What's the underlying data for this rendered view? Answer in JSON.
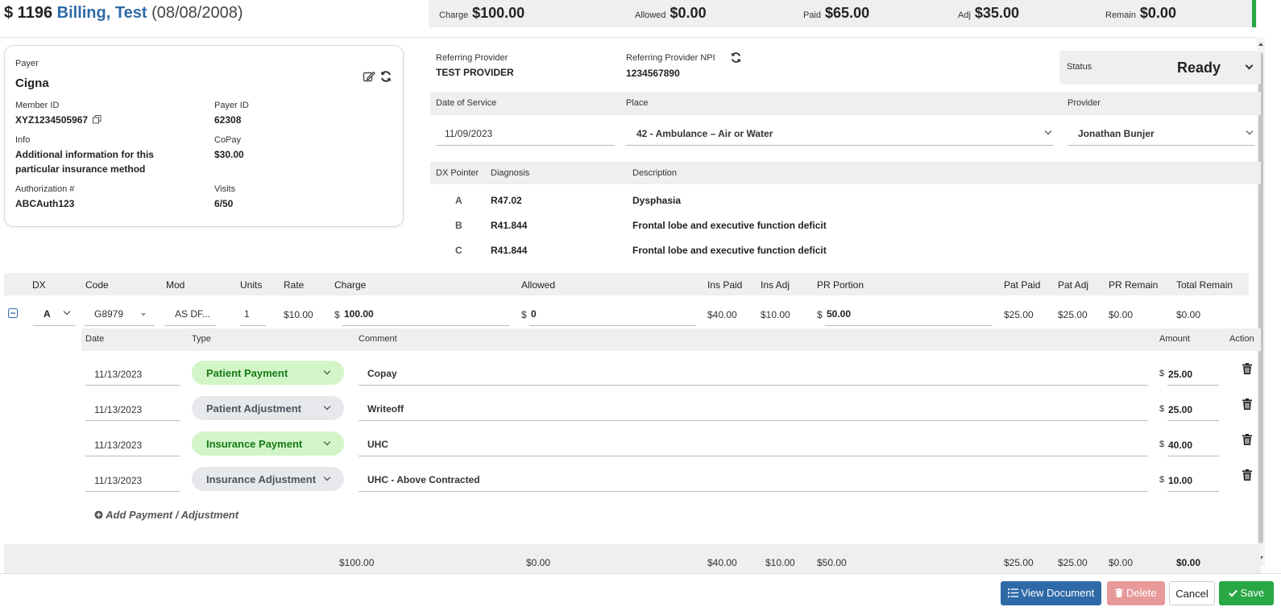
{
  "header": {
    "patient_id": "$ 1196",
    "patient_name": "Billing, Test",
    "dob": "(08/08/2008)"
  },
  "summary": [
    {
      "label": "Charge",
      "value": "$100.00"
    },
    {
      "label": "Allowed",
      "value": "$0.00"
    },
    {
      "label": "Paid",
      "value": "$65.00"
    },
    {
      "label": "Adj",
      "value": "$35.00"
    },
    {
      "label": "Remain",
      "value": "$0.00"
    }
  ],
  "payer_card": {
    "payer_label": "Payer",
    "payer": "Cigna",
    "member_id_label": "Member ID",
    "member_id": "XYZ1234505967",
    "payer_id_label": "Payer ID",
    "payer_id": "62308",
    "info_label": "Info",
    "info_line1": "Additional information for this",
    "info_line2": "particular insurance method",
    "copay_label": "CoPay",
    "copay": "$30.00",
    "auth_label": "Authorization #",
    "auth": "ABCAuth123",
    "visits_label": "Visits",
    "visits": "6/50"
  },
  "referring": {
    "provider_label": "Referring Provider",
    "provider": "TEST PROVIDER",
    "npi_label": "Referring Provider NPI",
    "npi": "1234567890"
  },
  "status": {
    "label": "Status",
    "value": "Ready"
  },
  "service": {
    "dos_label": "Date of Service",
    "dos": "11/09/2023",
    "place_label": "Place",
    "place": "42 - Ambulance – Air or Water",
    "provider_label": "Provider",
    "provider": "Jonathan Bunjer"
  },
  "diagnosis": {
    "headers": {
      "pointer": "DX Pointer",
      "diagnosis": "Diagnosis",
      "description": "Description"
    },
    "rows": [
      {
        "pointer": "A",
        "code": "R47.02",
        "desc": "Dysphasia"
      },
      {
        "pointer": "B",
        "code": "R41.844",
        "desc": "Frontal lobe and executive function deficit"
      },
      {
        "pointer": "C",
        "code": "R41.844",
        "desc": "Frontal lobe and executive function deficit"
      }
    ]
  },
  "lines": {
    "headers": {
      "dx": "DX",
      "code": "Code",
      "mod": "Mod",
      "units": "Units",
      "rate": "Rate",
      "charge": "Charge",
      "allowed": "Allowed",
      "ins_paid": "Ins Paid",
      "ins_adj": "Ins Adj",
      "pr_portion": "PR Portion",
      "pat_paid": "Pat Paid",
      "pat_adj": "Pat Adj",
      "pr_remain": "PR Remain",
      "total_remain": "Total Remain"
    },
    "row": {
      "dx": "A",
      "code": "G8979",
      "mod": "AS DF...",
      "units": "1",
      "rate": "$10.00",
      "charge_prefix": "$",
      "charge": "100.00",
      "allowed_prefix": "$",
      "allowed": "0",
      "ins_paid": "$40.00",
      "ins_adj": "$10.00",
      "pr_prefix": "$",
      "pr_portion": "50.00",
      "pat_paid": "$25.00",
      "pat_adj": "$25.00",
      "pr_remain": "$0.00",
      "total_remain": "$0.00"
    }
  },
  "payments": {
    "headers": {
      "date": "Date",
      "type": "Type",
      "comment": "Comment",
      "amount": "Amount",
      "action": "Action"
    },
    "rows": [
      {
        "date": "11/13/2023",
        "type": "Patient Payment",
        "kind": "green",
        "comment": "Copay",
        "prefix": "$",
        "amount": "25.00"
      },
      {
        "date": "11/13/2023",
        "type": "Patient Adjustment",
        "kind": "grey",
        "comment": "Writeoff",
        "prefix": "$",
        "amount": "25.00"
      },
      {
        "date": "11/13/2023",
        "type": "Insurance Payment",
        "kind": "green",
        "comment": "UHC",
        "prefix": "$",
        "amount": "40.00"
      },
      {
        "date": "11/13/2023",
        "type": "Insurance Adjustment",
        "kind": "grey",
        "comment": "UHC - Above Contracted",
        "prefix": "$",
        "amount": "10.00"
      }
    ],
    "add_label": "Add Payment / Adjustment"
  },
  "totals": {
    "charge": "$100.00",
    "allowed": "$0.00",
    "ins_paid": "$40.00",
    "ins_adj": "$10.00",
    "pr_portion": "$50.00",
    "pat_paid": "$25.00",
    "pat_adj": "$25.00",
    "pr_remain": "$0.00",
    "total_remain": "$0.00"
  },
  "footer": {
    "view_document": "View Document",
    "delete": "Delete",
    "cancel": "Cancel",
    "save": "Save"
  },
  "colors": {
    "brand_blue": "#2f6aa8",
    "green": "#28a745",
    "red_light": "#e89a9a",
    "pill_green": "#d2f5c8",
    "pill_grey": "#e6e8eb"
  }
}
